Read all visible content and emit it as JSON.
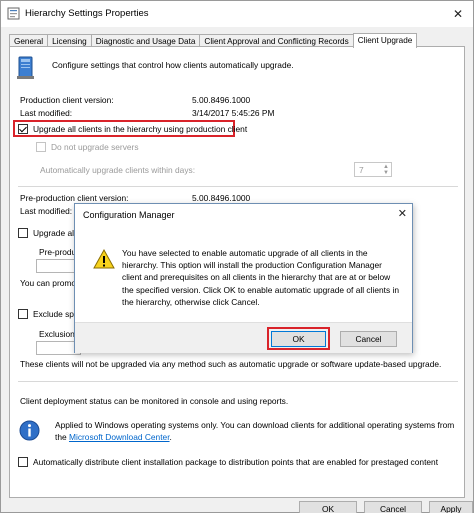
{
  "window": {
    "title": "Hierarchy Settings Properties"
  },
  "tabs": [
    {
      "label": "General",
      "active": false
    },
    {
      "label": "Licensing",
      "active": false
    },
    {
      "label": "Diagnostic and Usage Data",
      "active": false
    },
    {
      "label": "Client Approval and Conflicting Records",
      "active": false
    },
    {
      "label": "Client Upgrade",
      "active": true
    }
  ],
  "panel": {
    "header_text": "Configure settings that control how clients automatically upgrade.",
    "production": {
      "version_label": "Production client version:",
      "version_value": "5.00.8496.1000",
      "modified_label": "Last modified:",
      "modified_value": "3/14/2017 5:45:26 PM",
      "upgrade_all_label": "Upgrade all clients in the hierarchy using production client",
      "upgrade_all_checked": true,
      "no_upgrade_servers_label": "Do not upgrade servers",
      "auto_upgrade_days_label": "Automatically upgrade clients within days:",
      "auto_upgrade_days_value": "7"
    },
    "preproduction": {
      "version_label": "Pre-production client version:",
      "version_value": "5.00.8496.1000",
      "modified_label": "Last modified:",
      "upgrade_all_label": "Upgrade all",
      "preprod_label": "Pre-produc",
      "promote_text": "You can promote"
    },
    "exclude": {
      "checkbox_label": "Exclude spec",
      "collection_label": "Exclusion c",
      "note": "These clients will not be upgraded via any method such as automatic upgrade or software update-based upgrade."
    },
    "deployment_status_text": "Client deployment status can be monitored in console and using reports.",
    "info_text_1": "Applied to Windows operating systems only. You can download clients for additional operating systems from",
    "info_text_2_prefix": "the ",
    "info_link": "Microsoft Download Center",
    "info_text_2_suffix": ".",
    "auto_distribute_label": "Automatically distribute client installation package to distribution points that are enabled for prestaged content"
  },
  "buttons": {
    "ok": "OK",
    "cancel": "Cancel",
    "apply": "Apply"
  },
  "dialog": {
    "title": "Configuration Manager",
    "message": "You have selected to enable automatic upgrade of all clients in the hierarchy. This option will install the production Configuration Manager client and prerequisites on all clients in the hierarchy that are at or below the specified version.  Click OK to enable automatic upgrade of all clients in the hierarchy, otherwise click Cancel.",
    "ok_label": "OK",
    "cancel_label": "Cancel"
  },
  "colors": {
    "highlight_red": "#d9232a",
    "link_blue": "#0066cc",
    "focus_blue": "#0078d7"
  }
}
